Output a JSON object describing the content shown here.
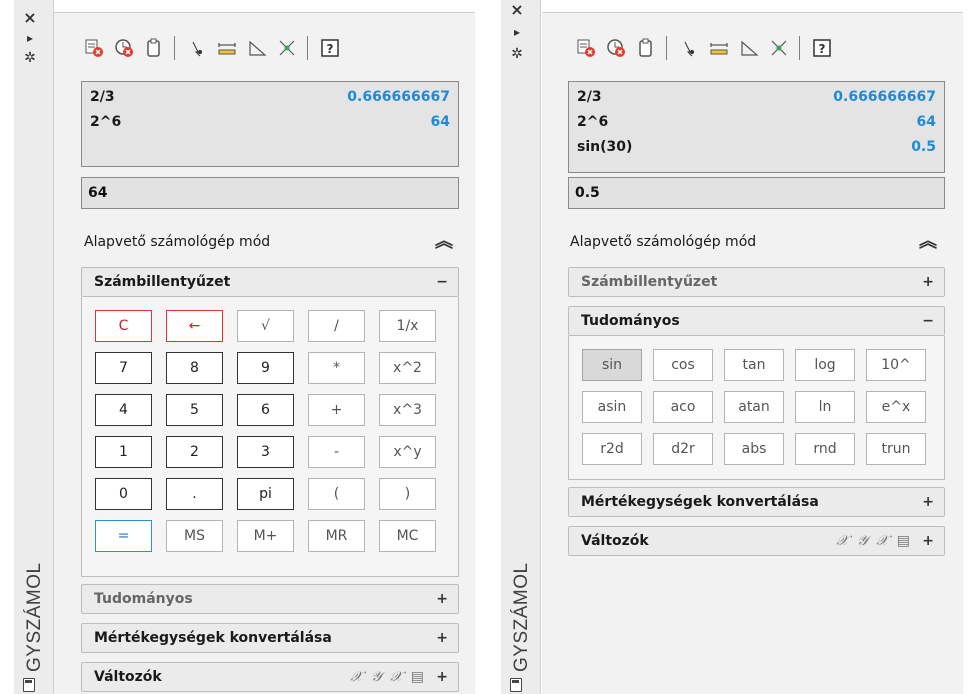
{
  "left": {
    "title": "GYSZÁMOL",
    "history": [
      {
        "expr": "2/3",
        "result": "0.666666667"
      },
      {
        "expr": "2^6",
        "result": "64"
      }
    ],
    "input": "64",
    "mode_label": "Alapvető számológép mód",
    "sections": {
      "keypad": "Számbillentyűzet",
      "scientific": "Tudományos",
      "units": "Mértékegységek konvertálása",
      "variables": "Változók"
    },
    "keys": [
      "C",
      "←",
      "√",
      "/",
      "1/x",
      "7",
      "8",
      "9",
      "*",
      "x^2",
      "4",
      "5",
      "6",
      "+",
      "x^3",
      "1",
      "2",
      "3",
      "-",
      "x^y",
      "0",
      ".",
      "pi",
      "(",
      ")",
      "=",
      "MS",
      "M+",
      "MR",
      "MC"
    ]
  },
  "right": {
    "title": "GYSZÁMOL",
    "history": [
      {
        "expr": "2/3",
        "result": "0.666666667"
      },
      {
        "expr": "2^6",
        "result": "64"
      },
      {
        "expr": "sin(30)",
        "result": "0.5"
      }
    ],
    "input": "0.5",
    "mode_label": "Alapvető számológép mód",
    "sections": {
      "keypad": "Számbillentyűzet",
      "scientific": "Tudományos",
      "units": "Mértékegységek konvertálása",
      "variables": "Változók"
    },
    "sci_keys": [
      "sin",
      "cos",
      "tan",
      "log",
      "10^",
      "asin",
      "aco",
      "atan",
      "ln",
      "e^x",
      "r2d",
      "d2r",
      "abs",
      "rnd",
      "trun"
    ]
  },
  "symbols": {
    "expand": "+",
    "collapse": "−",
    "chevron": "≈"
  },
  "colors": {
    "result_blue": "#1e8ad8",
    "clear_red": "#d12020",
    "equals_blue": "#1e78c8"
  }
}
